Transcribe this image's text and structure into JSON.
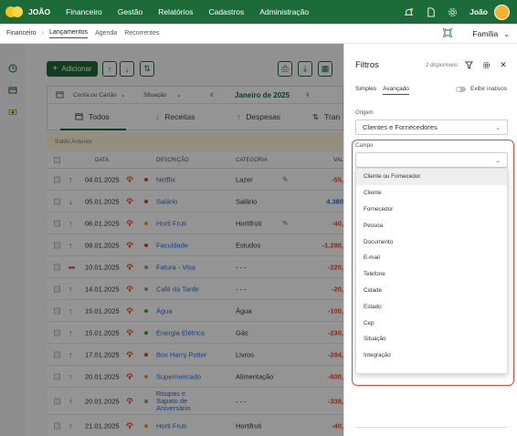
{
  "topnav": {
    "brand": "JOÃO",
    "items": [
      "Financeiro",
      "Gestão",
      "Relatórios",
      "Cadastros",
      "Administração"
    ],
    "user": "João",
    "icons": [
      "bell-icon",
      "document-icon",
      "settings-icon"
    ]
  },
  "breadcrumb": {
    "root": "Financeiro",
    "current": "Lançamentos",
    "subtabs": [
      "Agenda",
      "Recorrentes"
    ],
    "family": "Família"
  },
  "toolbar": {
    "add_label": "Adicionar"
  },
  "filterbar": {
    "account": "Conta ou Cartão",
    "status": "Situação",
    "month": "Janeiro de 2025"
  },
  "tabs": [
    "Todos",
    "Receitas",
    "Despesas",
    "Tran"
  ],
  "saldo_label": "Saldo Anterior",
  "table": {
    "headers": [
      "DATA",
      "DESCRIÇÃO",
      "CATEGORIA",
      "VAL"
    ],
    "rows": [
      {
        "date": "04.01.2025",
        "dir": "up",
        "dot": "#e53935",
        "desc": "Netflix",
        "cat": "Lazer",
        "edit": true,
        "val": "-55,"
      },
      {
        "date": "05.01.2025",
        "dir": "down",
        "dot": "#e53935",
        "desc": "Salário",
        "cat": "Salário",
        "edit": false,
        "val": "4.380"
      },
      {
        "date": "06.01.2025",
        "dir": "up",
        "dot": "#f39c12",
        "desc": "Horti Fruti",
        "cat": "Hortifruti",
        "edit": true,
        "val": "-40,"
      },
      {
        "date": "08.01.2025",
        "dir": "up",
        "dot": "#e53935",
        "desc": "Faculdade",
        "cat": "Estudos",
        "edit": false,
        "val": "-1.280,"
      },
      {
        "date": "10.01.2025",
        "dir": "card",
        "dot": "#999999",
        "desc": "Fatura - Visa",
        "cat": "- - -",
        "edit": false,
        "val": "-220,"
      },
      {
        "date": "14.01.2025",
        "dir": "up",
        "dot": "#999999",
        "desc": "Café da Tarde",
        "cat": "- - -",
        "edit": false,
        "val": "-20,"
      },
      {
        "date": "15.01.2025",
        "dir": "up",
        "dot": "#43a047",
        "desc": "Água",
        "cat": "Água",
        "edit": false,
        "val": "-100,"
      },
      {
        "date": "15.01.2025",
        "dir": "up",
        "dot": "#43a047",
        "desc": "Energia Elétrica",
        "cat": "Gás",
        "edit": false,
        "val": "-230,"
      },
      {
        "date": "17.01.2025",
        "dir": "up",
        "dot": "#e53935",
        "desc": "Box Harry Potter",
        "cat": "Livros",
        "edit": false,
        "val": "-284,"
      },
      {
        "date": "20.01.2025",
        "dir": "up",
        "dot": "#f39c12",
        "desc": "Supermercado",
        "cat": "Alimentação",
        "edit": false,
        "val": "-600,"
      },
      {
        "date": "20.01.2025",
        "dir": "up",
        "dot": "#999999",
        "desc": "Roupas e\nSapato de\nAniversário",
        "cat": "- - -",
        "edit": false,
        "val": "-338,"
      },
      {
        "date": "21.01.2025",
        "dir": "up",
        "dot": "#f39c12",
        "desc": "Horti Fruti",
        "cat": "Hortifruti",
        "edit": false,
        "val": "-40,"
      }
    ]
  },
  "panel": {
    "title": "Filtros",
    "count": "2 disponíveis",
    "tabs": [
      "Simples",
      "Avançado"
    ],
    "inativos_label": "Exibir inativos",
    "origem_label": "Origem",
    "origem_value": "Clientes e Fornecedores",
    "campo_label": "Campo",
    "campo_value": "",
    "options": [
      "Cliente ou Fornecedor",
      "Cliente",
      "Fornecedor",
      "Pessoa",
      "Documento",
      "E-mail",
      "Telefone",
      "Cidade",
      "Estado",
      "Cep",
      "Situação",
      "Integração"
    ]
  },
  "colors": {
    "brand": "#1e6b3a",
    "expense": "#e44b2e",
    "income": "#2d6fd6",
    "highlight": "#e0463c"
  }
}
